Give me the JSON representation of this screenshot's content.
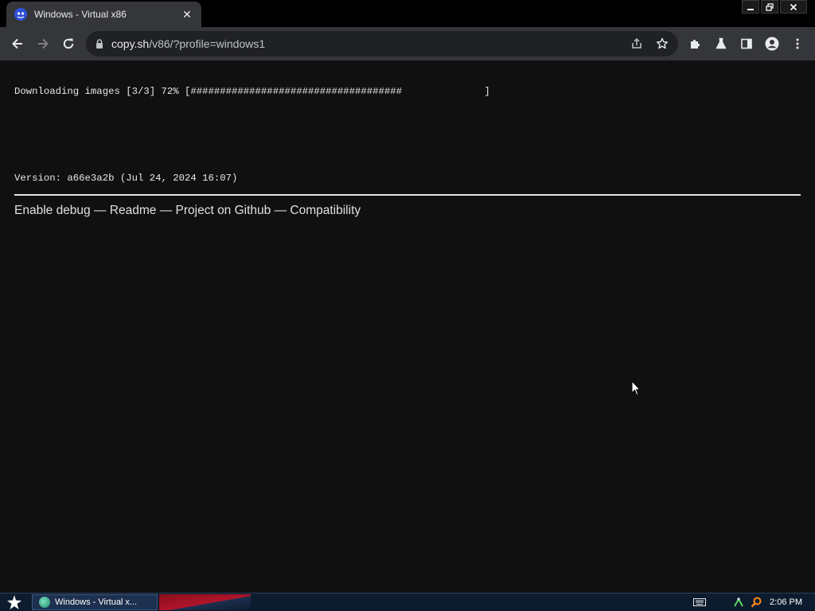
{
  "window": {
    "tab_title": "Windows - Virtual x86",
    "tab_close": "✕"
  },
  "toolbar": {
    "url_host": "copy.sh",
    "url_path": "/v86/?profile=windows1"
  },
  "page": {
    "progress_text": "Downloading images [3/3] 72% [####################################              ]",
    "version_text": "Version: a66e3a2b (Jul 24, 2024 16:07)",
    "links": [
      {
        "label": "Enable debug"
      },
      {
        "label": "Readme"
      },
      {
        "label": "Project on Github"
      },
      {
        "label": "Compatibility"
      }
    ],
    "separator": " — "
  },
  "taskbar": {
    "task_label": "Windows - Virtual x...",
    "clock": "2:06 PM"
  },
  "colors": {
    "page_bg": "#101010",
    "toolbar_bg": "#35363a",
    "omnibox_bg": "#202124",
    "taskbar_bg": "#0d1b2e"
  },
  "icons": {
    "favicon": "v86-favicon-icon",
    "back": "arrow-left-icon",
    "forward": "arrow-right-icon",
    "reload": "reload-icon",
    "lock": "lock-icon",
    "share": "share-icon",
    "bookmark": "star-icon",
    "extensions": "puzzle-icon",
    "labs": "flask-icon",
    "side_panel": "side-panel-icon",
    "profile": "profile-icon",
    "menu": "kebab-menu-icon"
  }
}
